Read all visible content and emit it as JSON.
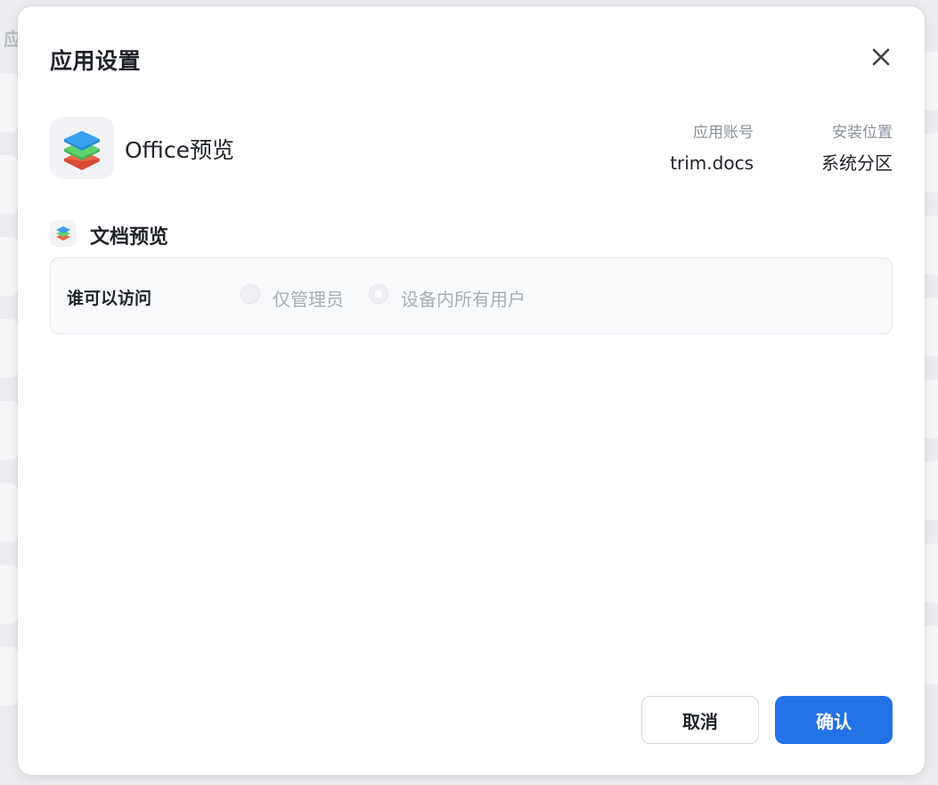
{
  "background": {
    "heading_fragment": "应"
  },
  "dialog": {
    "title": "应用设置",
    "close_icon": "close-icon"
  },
  "app": {
    "icon": "layers-stack-icon",
    "name": "Office预览",
    "account_label": "应用账号",
    "account_value": "trim.docs",
    "location_label": "安装位置",
    "location_value": "系统分区"
  },
  "section": {
    "icon": "layers-stack-icon",
    "title": "文档预览"
  },
  "permission": {
    "label": "谁可以访问",
    "options": [
      {
        "label": "仅管理员",
        "checked": false
      },
      {
        "label": "设备内所有用户",
        "checked": true
      }
    ],
    "disabled": true
  },
  "footer": {
    "cancel_label": "取消",
    "confirm_label": "确认"
  },
  "colors": {
    "accent": "#2473e6",
    "layer_top": "#3aa0f0",
    "layer_mid": "#5fd36a",
    "layer_bottom": "#f0654a"
  }
}
